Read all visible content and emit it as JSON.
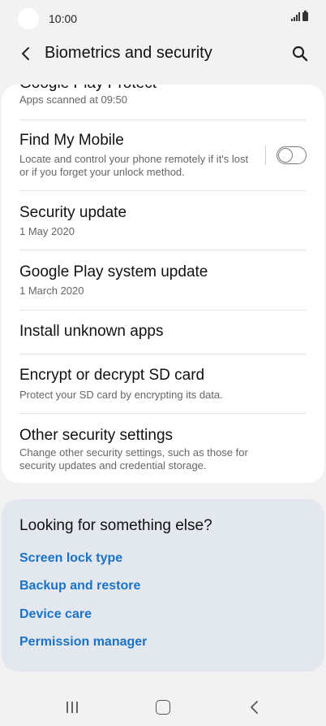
{
  "status": {
    "time": "10:00"
  },
  "header": {
    "title": "Biometrics and security"
  },
  "list": {
    "clipped_item": {
      "title": "Google Play Protect",
      "subtitle": "Apps scanned at 09:50"
    },
    "items": [
      {
        "title": "Find My Mobile",
        "subtitle": "Locate and control your phone remotely if it's lost or if you forget your unlock method.",
        "toggle": "off"
      },
      {
        "title": "Security update",
        "subtitle": "1 May 2020"
      },
      {
        "title": "Google Play system update",
        "subtitle": "1 March 2020"
      },
      {
        "title": "Install unknown apps"
      },
      {
        "title": "Encrypt or decrypt SD card",
        "subtitle": "Protect your SD card by encrypting its data."
      },
      {
        "title": "Other security settings",
        "subtitle": "Change other security settings, such as those for security updates and credential storage."
      }
    ]
  },
  "suggestions": {
    "heading": "Looking for something else?",
    "links": [
      "Screen lock type",
      "Backup and restore",
      "Device care",
      "Permission manager"
    ],
    "link_color": "#1a73c6"
  },
  "nav": {
    "icons": [
      "recents-icon",
      "home-icon",
      "back-icon"
    ]
  }
}
